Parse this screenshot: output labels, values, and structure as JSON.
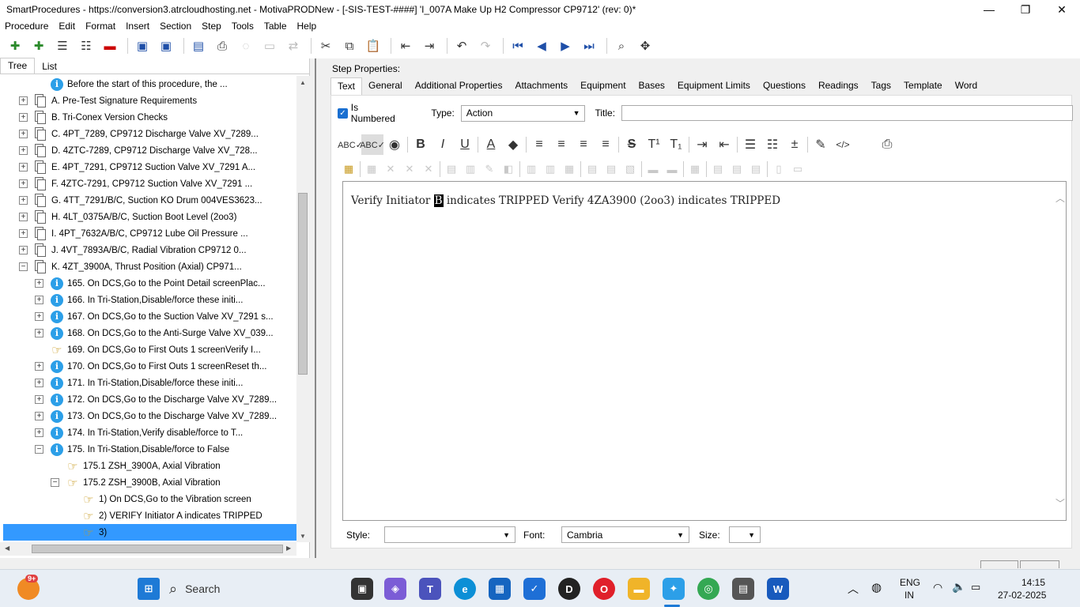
{
  "window": {
    "title": "SmartProcedures - https://conversion3.atrcloudhosting.net - MotivaPRODNew - [-SIS-TEST-####] 'I_007A Make Up H2 Compressor CP9712' (rev: 0)*",
    "minimize": "—",
    "maximize": "❐",
    "close": "✕"
  },
  "menu": [
    "Procedure",
    "Edit",
    "Format",
    "Insert",
    "Section",
    "Step",
    "Tools",
    "Table",
    "Help"
  ],
  "left": {
    "tabs": [
      "Tree",
      "List"
    ],
    "tree": [
      {
        "expander": "",
        "icon": "info",
        "label": "Before the start of this procedure, the ...",
        "indent": 1
      },
      {
        "expander": "+",
        "icon": "doc",
        "label": "A. Pre-Test Signature Requirements",
        "indent": 0
      },
      {
        "expander": "+",
        "icon": "doc",
        "label": "B. Tri-Conex Version Checks",
        "indent": 0
      },
      {
        "expander": "+",
        "icon": "doc",
        "label": "C. 4PT_7289, CP9712 Discharge Valve XV_7289...",
        "indent": 0
      },
      {
        "expander": "+",
        "icon": "doc",
        "label": "D. 4ZTC-7289, CP9712 Discharge Valve XV_728...",
        "indent": 0
      },
      {
        "expander": "+",
        "icon": "doc",
        "label": "E. 4PT_7291, CP9712 Suction Valve XV_7291 A...",
        "indent": 0
      },
      {
        "expander": "+",
        "icon": "doc",
        "label": "F. 4ZTC-7291, CP9712 Suction Valve XV_7291 ...",
        "indent": 0
      },
      {
        "expander": "+",
        "icon": "doc",
        "label": "G. 4TT_7291/B/C, Suction KO Drum 004VES3623...",
        "indent": 0
      },
      {
        "expander": "+",
        "icon": "doc",
        "label": "H. 4LT_0375A/B/C, Suction Boot Level (2oo3)",
        "indent": 0
      },
      {
        "expander": "+",
        "icon": "doc",
        "label": "I. 4PT_7632A/B/C, CP9712 Lube Oil Pressure ...",
        "indent": 0
      },
      {
        "expander": "+",
        "icon": "doc",
        "label": "J. 4VT_7893A/B/C, Radial Vibration CP9712 0...",
        "indent": 0
      },
      {
        "expander": "−",
        "icon": "doc",
        "label": "K. 4ZT_3900A, Thrust Position (Axial) CP971...",
        "indent": 0
      },
      {
        "expander": "+",
        "icon": "info",
        "label": "165. On DCS,Go to the Point Detail screenPlac...",
        "indent": 1
      },
      {
        "expander": "+",
        "icon": "info",
        "label": "166. In Tri-Station,Disable/force these initi...",
        "indent": 1
      },
      {
        "expander": "+",
        "icon": "info",
        "label": "167. On DCS,Go to the Suction Valve XV_7291 s...",
        "indent": 1
      },
      {
        "expander": "+",
        "icon": "info",
        "label": "168. On DCS,Go to the Anti-Surge Valve XV_039...",
        "indent": 1
      },
      {
        "expander": "",
        "icon": "hand",
        "label": "169. On DCS,Go to First Outs 1 screenVerify I...",
        "indent": 1
      },
      {
        "expander": "+",
        "icon": "info",
        "label": "170. On DCS,Go to First Outs 1 screenReset th...",
        "indent": 1
      },
      {
        "expander": "+",
        "icon": "info",
        "label": "171. In Tri-Station,Disable/force these initi...",
        "indent": 1
      },
      {
        "expander": "+",
        "icon": "info",
        "label": "172. On DCS,Go to the Discharge Valve XV_7289...",
        "indent": 1
      },
      {
        "expander": "+",
        "icon": "info",
        "label": "173. On DCS,Go to the Discharge Valve XV_7289...",
        "indent": 1
      },
      {
        "expander": "+",
        "icon": "info",
        "label": "174. In Tri-Station,Verify disable/force to T...",
        "indent": 1
      },
      {
        "expander": "−",
        "icon": "info",
        "label": "175. In Tri-Station,Disable/force to False",
        "indent": 1
      },
      {
        "expander": "",
        "icon": "hand",
        "label": "175.1 ZSH_3900A, Axial Vibration",
        "indent": 2
      },
      {
        "expander": "−",
        "icon": "hand",
        "label": "175.2 ZSH_3900B, Axial Vibration",
        "indent": 2
      },
      {
        "expander": "",
        "icon": "hand",
        "label": "1) On DCS,Go to the Vibration screen",
        "indent": 3
      },
      {
        "expander": "",
        "icon": "hand",
        "label": "2) VERIFY Initiator A indicates TRIPPED",
        "indent": 3
      },
      {
        "expander": "",
        "icon": "hand",
        "label": "3)",
        "indent": 3,
        "selected": true
      }
    ]
  },
  "right": {
    "heading": "Step Properties:",
    "tabs": [
      "Text",
      "General",
      "Additional Properties",
      "Attachments",
      "Equipment",
      "Bases",
      "Equipment Limits",
      "Questions",
      "Readings",
      "Tags",
      "Template",
      "Word"
    ],
    "is_numbered_label": "Is Numbered",
    "type_label": "Type:",
    "type_value": "Action",
    "title_label": "Title:",
    "title_value": "",
    "editor": {
      "before": "Verify Initiator ",
      "cursor": "B",
      "after": " indicates TRIPPED Verify 4ZA3900 (2oo3) indicates TRIPPED"
    },
    "style_label": "Style:",
    "style_value": "",
    "font_label": "Font:",
    "font_value": "Cambria",
    "size_label": "Size:",
    "size_value": ""
  },
  "taskbar": {
    "search_label": "Search",
    "badge": "9+",
    "lang": "ENG",
    "region": "IN",
    "time": "14:15",
    "date": "27-02-2025"
  },
  "colors": {
    "selected_row": "#3399ff",
    "info_icon": "#2c9fe8"
  }
}
